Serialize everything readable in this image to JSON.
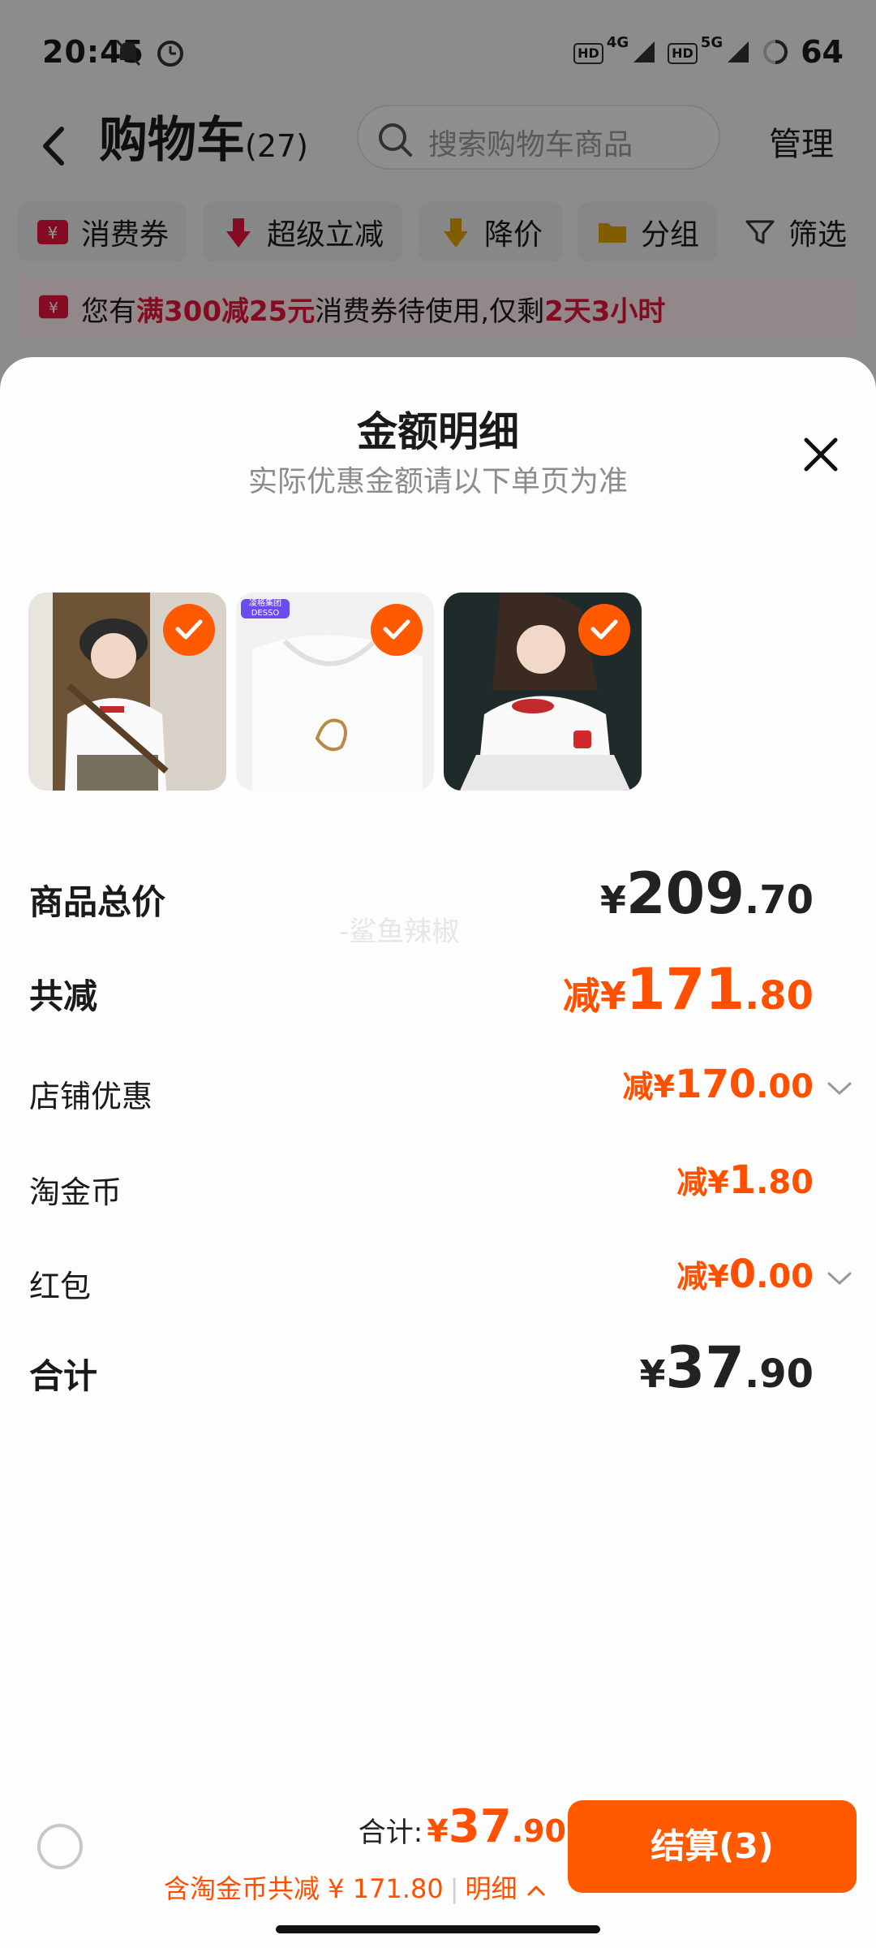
{
  "status_bar": {
    "time": "20:45",
    "signal1_tag": "HD",
    "signal1_gen": "4G",
    "signal2_tag": "HD",
    "signal2_gen": "5G",
    "battery": "64"
  },
  "nav": {
    "title": "购物车",
    "count": "(27)",
    "search_placeholder": "搜索购物车商品",
    "manage": "管理"
  },
  "filters": [
    {
      "label": "消费券"
    },
    {
      "label": "超级立减"
    },
    {
      "label": "降价"
    },
    {
      "label": "分组"
    },
    {
      "label": "筛选"
    }
  ],
  "promo": {
    "p1": "您有",
    "p2": "满300减25元",
    "p3": "消费券待使用,仅剩",
    "p4": "2天3小时"
  },
  "sheet": {
    "title": "金额明细",
    "subtitle": "实际优惠金额请以下单页为准",
    "thumb_tag": "凌格集团 DESSO",
    "watermark": "-鲨鱼辣椒",
    "rows": {
      "total_price": {
        "label": "商品总价",
        "yen": "¥",
        "int": "209",
        "dec": ".70"
      },
      "total_discount": {
        "label": "共减",
        "prefix": "减",
        "yen": "¥",
        "int": "171",
        "dec": ".80"
      },
      "shop_discount": {
        "label": "店铺优惠",
        "prefix": "减",
        "yen": "¥",
        "int": "170",
        "dec": ".00"
      },
      "tao_coin": {
        "label": "淘金币",
        "prefix": "减",
        "yen": "¥",
        "int": "1",
        "dec": ".80"
      },
      "red_packet": {
        "label": "红包",
        "prefix": "减",
        "yen": "¥",
        "int": "0",
        "dec": ".00"
      },
      "sum": {
        "label": "合计",
        "yen": "¥",
        "int": "37",
        "dec": ".90"
      }
    }
  },
  "footer": {
    "total_label": "合计:",
    "total_yen": "¥",
    "total_int": "37",
    "total_dec": ".90",
    "coin_text": "含淘金币共减 ¥ 171.80",
    "sep": "|",
    "detail": "明细",
    "checkout": "结算(3)"
  },
  "colors": {
    "accent": "#ff5000",
    "promo_red": "#e3133a"
  },
  "icons": [
    "alarm-icon",
    "mute-icon",
    "back-icon",
    "search-icon",
    "coupon-icon",
    "arrow-down-icon",
    "folder-icon",
    "filter-icon",
    "close-icon",
    "check-icon",
    "chevron-down-icon",
    "chevron-up-icon"
  ]
}
